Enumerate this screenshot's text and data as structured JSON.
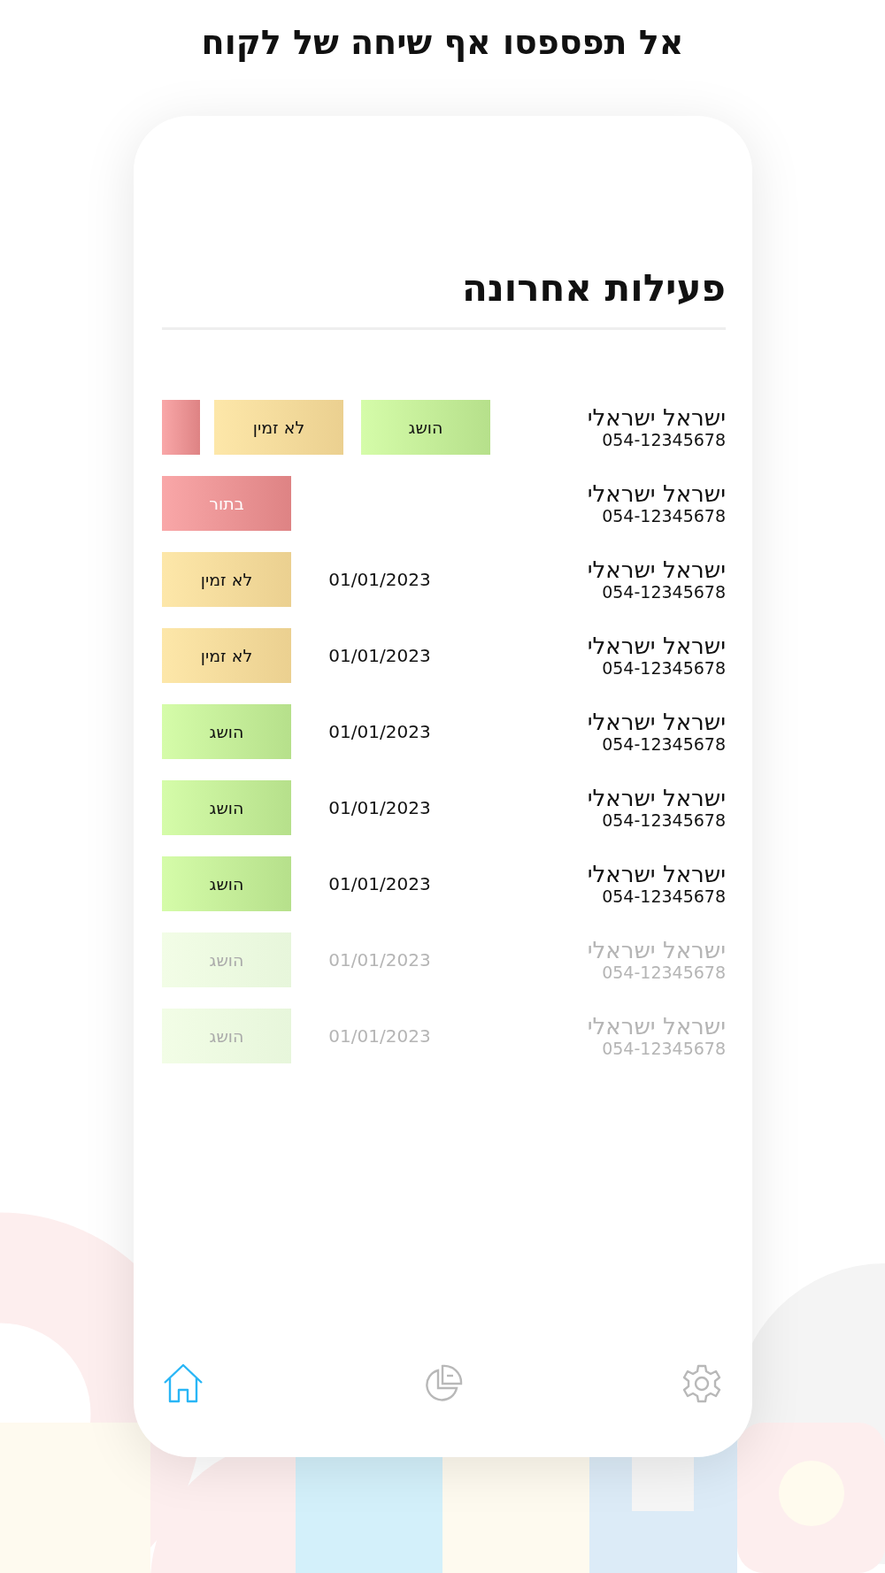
{
  "headline": "אל תפספסו אף שיחה של לקוח",
  "screen": {
    "title": "פעילות אחרונה",
    "rows": [
      {
        "kind": "swiped",
        "faded": false,
        "name": "ישראל ישראלי",
        "phone": "054-12345678",
        "status": {
          "label": "הושג",
          "kind": "achieved"
        },
        "actions": [
          {
            "kind": "unavailable",
            "label": "לא זמין"
          },
          {
            "kind": "queued"
          }
        ]
      },
      {
        "kind": "plain",
        "faded": false,
        "name": "ישראל ישראלי",
        "phone": "054-12345678",
        "status": {
          "label": "בתור",
          "kind": "queued"
        }
      },
      {
        "kind": "plain",
        "faded": false,
        "name": "ישראל ישראלי",
        "phone": "054-12345678",
        "date": "01/01/2023",
        "status": {
          "label": "לא זמין",
          "kind": "unavailable"
        }
      },
      {
        "kind": "plain",
        "faded": false,
        "name": "ישראל ישראלי",
        "phone": "054-12345678",
        "date": "01/01/2023",
        "status": {
          "label": "לא זמין",
          "kind": "unavailable"
        }
      },
      {
        "kind": "plain",
        "faded": false,
        "name": "ישראל ישראלי",
        "phone": "054-12345678",
        "date": "01/01/2023",
        "status": {
          "label": "הושג",
          "kind": "achieved"
        }
      },
      {
        "kind": "plain",
        "faded": false,
        "name": "ישראל ישראלי",
        "phone": "054-12345678",
        "date": "01/01/2023",
        "status": {
          "label": "הושג",
          "kind": "achieved"
        }
      },
      {
        "kind": "plain",
        "faded": false,
        "name": "ישראל ישראלי",
        "phone": "054-12345678",
        "date": "01/01/2023",
        "status": {
          "label": "הושג",
          "kind": "achieved"
        }
      },
      {
        "kind": "plain",
        "faded": true,
        "name": "ישראל ישראלי",
        "phone": "054-12345678",
        "date": "01/01/2023",
        "status": {
          "label": "הושג",
          "kind": "achieved"
        }
      },
      {
        "kind": "plain",
        "faded": true,
        "name": "ישראל ישראלי",
        "phone": "054-12345678",
        "date": "01/01/2023",
        "status": {
          "label": "הושג",
          "kind": "achieved"
        }
      }
    ],
    "nav": [
      {
        "kind": "home",
        "selected": true
      },
      {
        "kind": "chart",
        "selected": false
      },
      {
        "kind": "settings",
        "selected": false
      }
    ]
  }
}
